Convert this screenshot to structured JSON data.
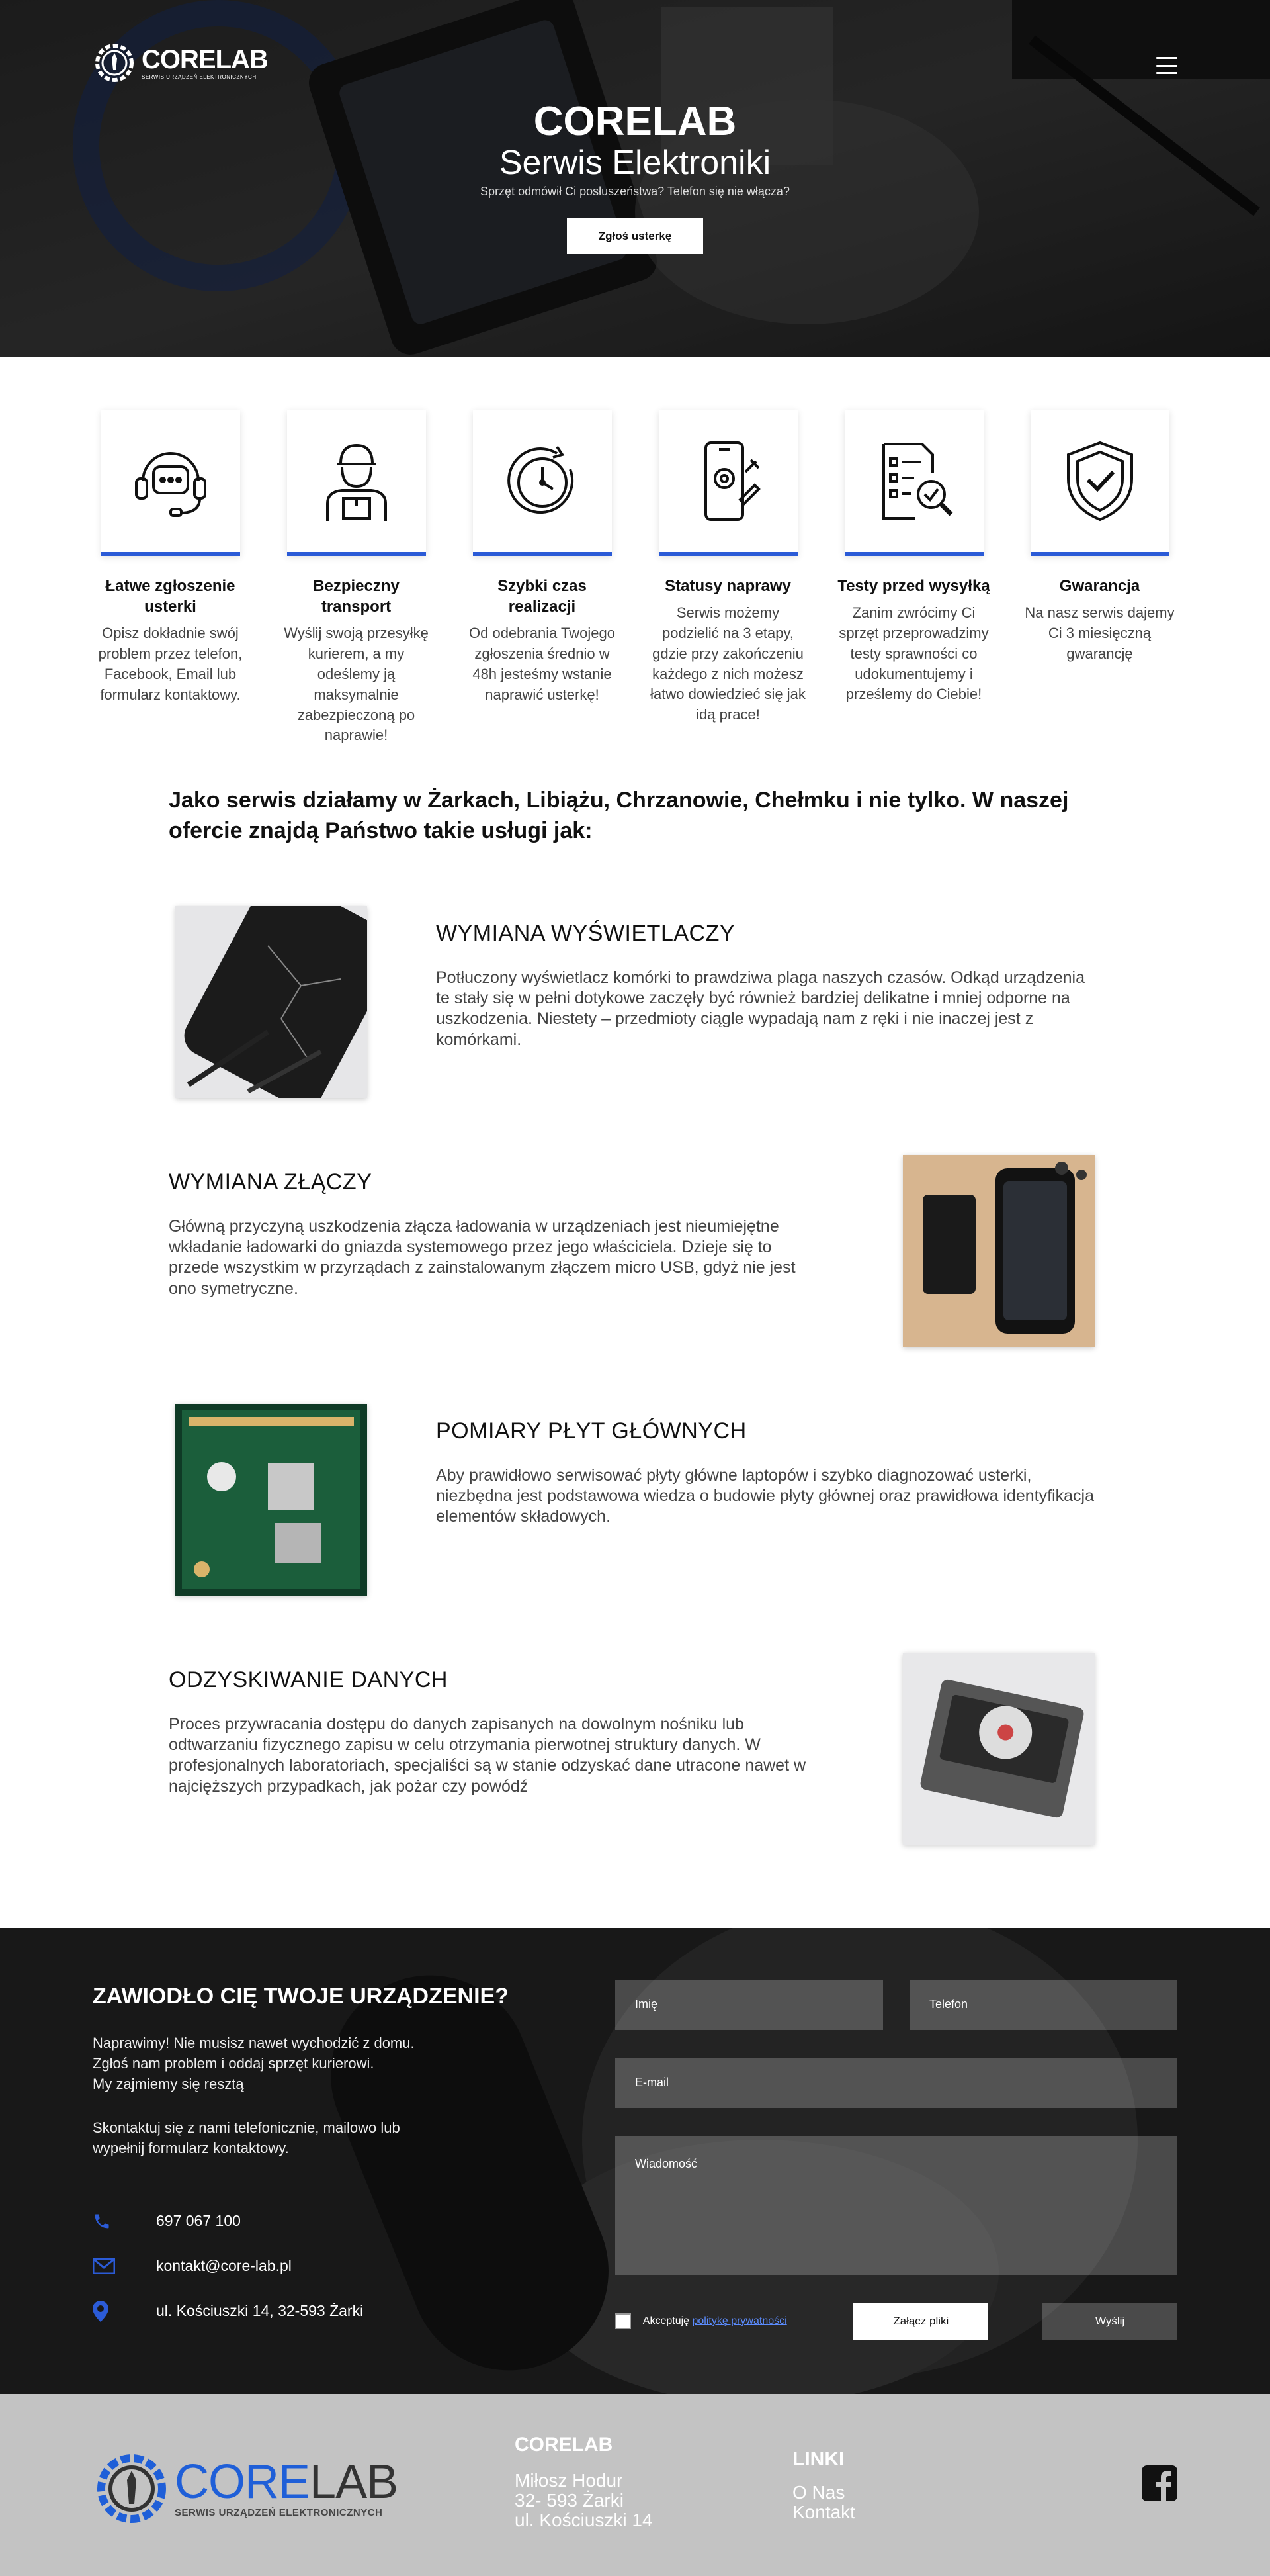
{
  "colors": {
    "accent": "#2b5bd7",
    "dark_bg": "#1c1c1c",
    "footer_bg": "#c3c3c3"
  },
  "hero": {
    "logo_name": "CORELAB",
    "logo_sub": "SERWIS URZĄDZEŃ ELEKTRONICZNYCH",
    "title": "CORELAB",
    "subtitle": "Serwis Elektroniki",
    "tagline": "Sprzęt odmówił Ci posłuszeństwa? Telefon się nie włącza?",
    "cta_label": "Zgłoś usterkę",
    "menu_icon": "hamburger-icon"
  },
  "features": [
    {
      "icon": "headset-chat-icon",
      "title": "Łatwe zgłoszenie usterki",
      "desc": "Opisz dokładnie swój problem przez telefon, Facebook, Email lub formularz kontaktowy."
    },
    {
      "icon": "courier-icon",
      "title": "Bezpieczny transport",
      "desc": "Wyślij swoją przesyłkę kurierem, a my odeślemy ją maksymalnie zabezpieczoną po naprawie!"
    },
    {
      "icon": "clock-icon",
      "title": "Szybki czas realizacji",
      "desc": "Od odebrania Twojego zgłoszenia średnio w 48h jesteśmy wstanie naprawić usterkę!"
    },
    {
      "icon": "phone-repair-icon",
      "title": "Statusy naprawy",
      "desc": "Serwis możemy podzielić na 3 etapy, gdzie przy zakończeniu każdego z nich możesz łatwo dowiedzieć się jak idą prace!"
    },
    {
      "icon": "checklist-icon",
      "title": "Testy przed wysyłką",
      "desc": "Zanim zwrócimy Ci sprzęt przeprowadzimy testy sprawności co udokumentujemy i prześlemy do Ciebie!"
    },
    {
      "icon": "shield-check-icon",
      "title": "Gwarancja",
      "desc": "Na nasz serwis dajemy Ci 3 miesięczną gwarancję"
    }
  ],
  "intro": "Jako serwis działamy w Żarkach, Libiążu, Chrzanowie, Chełmku i nie tylko. W naszej ofercie znajdą Państwo takie usługi jak:",
  "services": [
    {
      "title": "WYMIANA WYŚWIETLACZY",
      "desc": "Potłuczony wyświetlacz komórki to prawdziwa plaga naszych czasów. Odkąd urządzenia te stały się w pełni dotykowe zaczęły być również bardziej delikatne i mniej odporne na uszkodzenia. Niestety – przedmioty ciągle wypadają nam z ręki i nie inaczej jest z komórkami."
    },
    {
      "title": "WYMIANA ZŁĄCZY",
      "desc": "Główną przyczyną uszkodzenia złącza ładowania w urządzeniach jest nieumiejętne wkładanie ładowarki do gniazda systemowego przez jego właściciela. Dzieje się to przede wszystkim w przyrządach z zainstalowanym złączem micro USB, gdyż nie jest ono symetryczne."
    },
    {
      "title": "POMIARY PŁYT GŁÓWNYCH",
      "desc": "Aby prawidłowo serwisować płyty główne laptopów i szybko diagnozować usterki, niezbędna jest podstawowa wiedza o budowie płyty głównej oraz prawidłowa identyfikacja elementów składowych."
    },
    {
      "title": "ODZYSKIWANIE DANYCH",
      "desc": "Proces przywracania dostępu do danych zapisanych na dowolnym nośniku lub odtwarzaniu fizycznego zapisu w celu otrzymania pierwotnej struktury danych. W profesjonalnych laboratoriach, specjaliści są w stanie odzyskać dane utracone nawet w najcięższych przypadkach, jak pożar czy powódź"
    }
  ],
  "contact": {
    "title": "ZAWIODŁO CIĘ TWOJE URZĄDZENIE?",
    "p1_l1": "Naprawimy! Nie musisz nawet wychodzić z domu.",
    "p1_l2": "Zgłoś nam problem i oddaj sprzęt kurierowi.",
    "p1_l3": "My zajmiemy się resztą",
    "p2_l1": "Skontaktuj się z nami telefonicznie, mailowo lub",
    "p2_l2": "wypełnij formularz kontaktowy.",
    "phone": "697 067 100",
    "email": "kontakt@core-lab.pl",
    "address": "ul. Kościuszki 14, 32-593 Żarki",
    "form": {
      "name_ph": "Imię",
      "phone_ph": "Telefon",
      "email_ph": "E-mail",
      "message_ph": "Wiadomość",
      "accept_text": "Akceptuję",
      "privacy_link": "politykę prywatności",
      "attach_label": "Załącz pliki",
      "send_label": "Wyślij"
    }
  },
  "footer": {
    "logo_core": "CORE",
    "logo_lab": "LAB",
    "logo_sub": "SERWIS URZĄDZEŃ ELEKTRONICZNYCH",
    "col1_title": "CORELAB",
    "col1_l1": "Miłosz Hodur",
    "col1_l2": "32- 593 Żarki",
    "col1_l3": "ul. Kościuszki 14",
    "col2_title": "LINKI",
    "col2_l1": "O Nas",
    "col2_l2": "Kontakt",
    "social_icon": "facebook-icon"
  }
}
